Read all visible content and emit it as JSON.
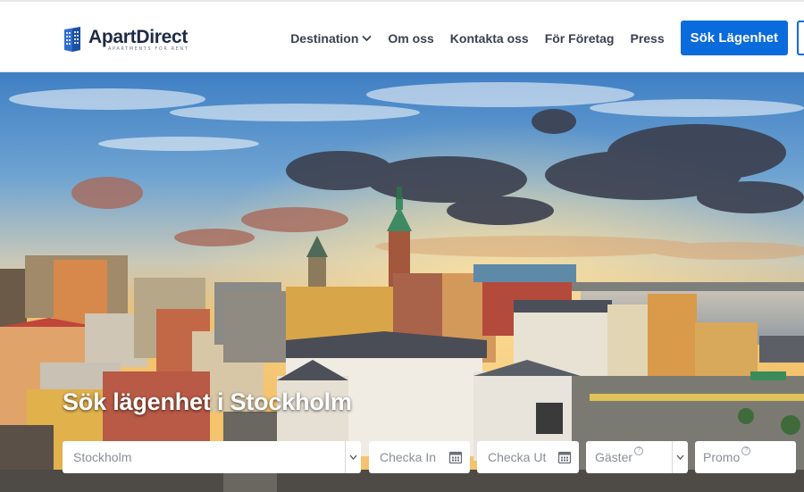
{
  "brand": {
    "name": "ApartDirect",
    "tagline": "APARTMENTS FOR RENT"
  },
  "nav": {
    "items": [
      {
        "label": "Destination",
        "has_dropdown": true
      },
      {
        "label": "Om oss"
      },
      {
        "label": "Kontakta oss"
      },
      {
        "label": "För Företag"
      },
      {
        "label": "Press"
      }
    ],
    "cta_label": "Sök Lägenhet"
  },
  "hero": {
    "title": "Sök lägenhet i Stockholm"
  },
  "search": {
    "city_value": "Stockholm",
    "checkin_placeholder": "Checka In",
    "checkout_placeholder": "Checka Ut",
    "guests_placeholder": "Gäster",
    "promo_placeholder": "Promo",
    "help_glyph": "?"
  },
  "colors": {
    "accent": "#0a6bdc",
    "brand_text": "#1f2a44"
  },
  "icons": {
    "logo": "building-icon",
    "dropdown": "chevron-down-icon",
    "date": "calendar-icon"
  }
}
